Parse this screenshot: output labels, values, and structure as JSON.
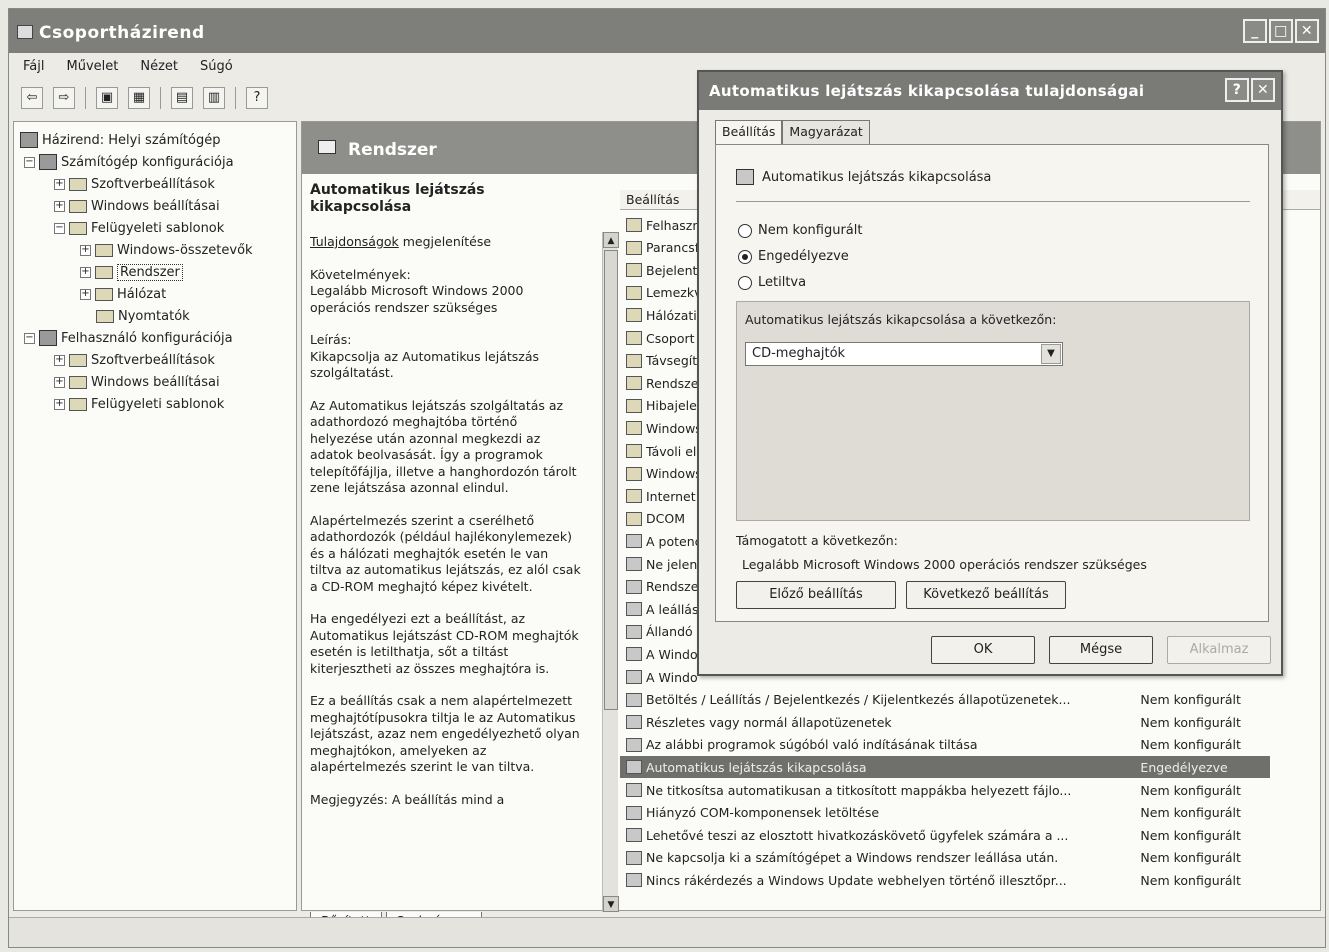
{
  "window": {
    "title": "Csoportházirend"
  },
  "menu": [
    "Fájl",
    "Művelet",
    "Nézet",
    "Súgó"
  ],
  "toolbar": {
    "icons": [
      "back-icon",
      "forward-icon",
      "up-icon",
      "show-hide-icon",
      "properties-icon",
      "export-icon",
      "help-icon"
    ],
    "glyphs": [
      "⇦",
      "⇨",
      "▣",
      "▦",
      "▤",
      "▥",
      "?"
    ]
  },
  "tree": [
    {
      "label": "Házirend: Helyi számítógép",
      "level": 0
    },
    {
      "label": "Számítógép konfigurációja",
      "level": 1
    },
    {
      "label": "Szoftverbeállítások",
      "level": 2
    },
    {
      "label": "Windows beállításai",
      "level": 2
    },
    {
      "label": "Felügyeleti sablonok",
      "level": 2
    },
    {
      "label": "Windows-összetevők",
      "level": 3
    },
    {
      "label": "Rendszer",
      "level": 3
    },
    {
      "label": "Hálózat",
      "level": 3
    },
    {
      "label": "Nyomtatók",
      "level": 3
    },
    {
      "label": "Felhasználó konfigurációja",
      "level": 1
    },
    {
      "label": "Szoftverbeállítások",
      "level": 2
    },
    {
      "label": "Windows beállításai",
      "level": 2
    },
    {
      "label": "Felügyeleti sablonok",
      "level": 2
    }
  ],
  "banner": {
    "title": "Rendszer"
  },
  "description": {
    "title": "Automatikus lejátszás kikapcsolása",
    "link": "Tulajdonságok",
    "link_suffix": " megjelenítése",
    "requirements": "Követelmények:\nLegalább Microsoft Windows 2000 operációs rendszer szükséges",
    "explain": "Leírás:\nKikapcsolja az Automatikus lejátszás szolgáltatást.",
    "p1": "Az Automatikus lejátszás szolgáltatás az adathordozó meghajtóba történő helyezése után azonnal megkezdi az adatok beolvasását. Így a programok telepítőfájlja, illetve a hanghordozón tárolt zene lejátszása azonnal elindul.",
    "p2": "Alapértelmezés szerint a cserélhető adathordozók (például hajlékonylemezek) és a hálózati meghajtók esetén le van tiltva az automatikus lejátszás, ez alól csak a CD-ROM meghajtó képez kivételt.",
    "p3": "Ha engedélyezi ezt a beállítást, az Automatikus lejátszást CD-ROM meghajtók esetén is letilthatja, sőt a tiltást kiterjesztheti az összes meghajtóra is.",
    "p4": "Ez a beállítás csak a nem alapértelmezett meghajtótípusokra tiltja le az Automatikus lejátszást, azaz nem engedélyezhető olyan meghajtókon, amelyeken az alapértelmezés szerint le van tiltva.",
    "p5": "Megjegyzés: A beállítás mind a"
  },
  "list": {
    "col_setting": "Beállítás",
    "rows": [
      {
        "name": "Felhaszn",
        "state": "",
        "type": "folder"
      },
      {
        "name": "Parancsf",
        "state": "",
        "type": "folder"
      },
      {
        "name": "Bejelentk",
        "state": "",
        "type": "folder"
      },
      {
        "name": "Lemezkv",
        "state": "",
        "type": "folder"
      },
      {
        "name": "Hálózati",
        "state": "",
        "type": "folder"
      },
      {
        "name": "Csoport",
        "state": "",
        "type": "folder"
      },
      {
        "name": "Távsegít",
        "state": "",
        "type": "folder"
      },
      {
        "name": "Rendsze",
        "state": "",
        "type": "folder"
      },
      {
        "name": "Hibajeler",
        "state": "",
        "type": "folder"
      },
      {
        "name": "Windows",
        "state": "",
        "type": "folder"
      },
      {
        "name": "Távoli el",
        "state": "",
        "type": "folder"
      },
      {
        "name": "Windows",
        "state": "",
        "type": "folder"
      },
      {
        "name": "Internet",
        "state": "",
        "type": "folder"
      },
      {
        "name": "DCOM",
        "state": "",
        "type": "folder"
      },
      {
        "name": "A potenc",
        "state": "",
        "type": "policy"
      },
      {
        "name": "Ne jelen",
        "state": "",
        "type": "policy"
      },
      {
        "name": "Rendsze",
        "state": "",
        "type": "policy"
      },
      {
        "name": "A leállás",
        "state": "",
        "type": "policy"
      },
      {
        "name": "Állandó i",
        "state": "",
        "type": "policy"
      },
      {
        "name": "A Windo",
        "state": "",
        "type": "policy"
      },
      {
        "name": "A Windo",
        "state": "",
        "type": "policy"
      },
      {
        "name": "Betöltés / Leállítás / Bejelentkezés / Kijelentkezés állapotüzenetek...",
        "state": "Nem konfigurált",
        "type": "policy"
      },
      {
        "name": "Részletes vagy normál állapotüzenetek",
        "state": "Nem konfigurált",
        "type": "policy"
      },
      {
        "name": "Az alábbi programok súgóból való indításának tiltása",
        "state": "Nem konfigurált",
        "type": "policy"
      },
      {
        "name": "Automatikus lejátszás kikapcsolása",
        "state": "Engedélyezve",
        "type": "policy",
        "selected": true
      },
      {
        "name": "Ne titkosítsa automatikusan a titkosított mappákba helyezett fájlo...",
        "state": "Nem konfigurált",
        "type": "policy"
      },
      {
        "name": "Hiányzó COM-komponensek letöltése",
        "state": "Nem konfigurált",
        "type": "policy"
      },
      {
        "name": "Lehetővé teszi az elosztott hivatkozáskövető ügyfelek számára a ...",
        "state": "Nem konfigurált",
        "type": "policy"
      },
      {
        "name": "Ne kapcsolja ki a számítógépet a Windows rendszer leállása után.",
        "state": "Nem konfigurált",
        "type": "policy"
      },
      {
        "name": "Nincs rákérdezés a Windows Update webhelyen történő illesztőpr...",
        "state": "Nem konfigurált",
        "type": "policy"
      }
    ]
  },
  "bottom_tabs": [
    "Bővített",
    "Szabványos"
  ],
  "dialog": {
    "title": "Automatikus lejátszás kikapcsolása tulajdonságai",
    "tabs": [
      "Beállítás",
      "Magyarázat"
    ],
    "policy_name": "Automatikus lejátszás kikapcsolása",
    "radios": [
      {
        "label": "Nem konfigurált",
        "checked": false
      },
      {
        "label": "Engedélyezve",
        "checked": true
      },
      {
        "label": "Letiltva",
        "checked": false
      }
    ],
    "option_label": "Automatikus lejátszás kikapcsolása a következőn:",
    "option_value": "CD-meghajtók",
    "supported_label": "Támogatott a következőn:",
    "supported_value": "Legalább Microsoft Windows 2000 operációs rendszer szükséges",
    "prev_button": "Előző beállítás",
    "next_button": "Következő beállítás",
    "ok_button": "OK",
    "cancel_button": "Mégse",
    "apply_button": "Alkalmaz"
  }
}
